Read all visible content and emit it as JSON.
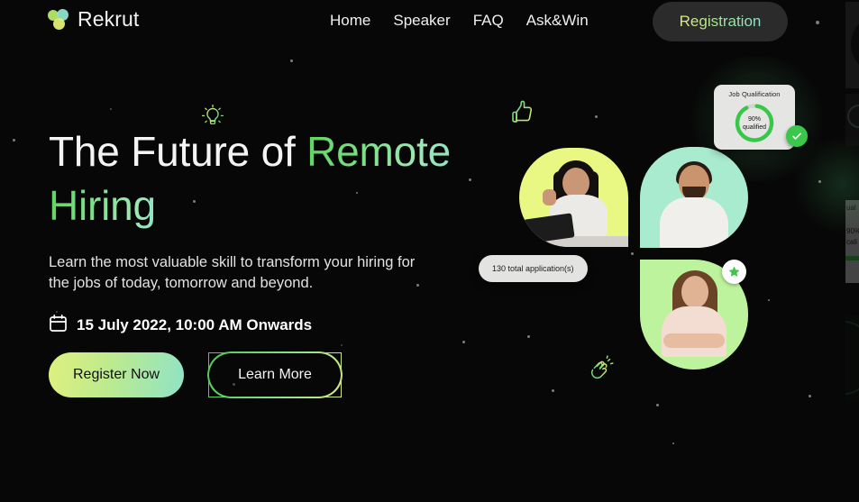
{
  "brand": {
    "name": "Rekrut",
    "logo_icon": "three-circles-logo-icon",
    "logo_colors": [
      "#b6e86a",
      "#8fe3cf",
      "#e4ef72"
    ]
  },
  "nav": {
    "links": [
      {
        "label": "Home",
        "name": "nav-link-home"
      },
      {
        "label": "Speaker",
        "name": "nav-link-speaker"
      },
      {
        "label": "FAQ",
        "name": "nav-link-faq"
      },
      {
        "label": "Ask&Win",
        "name": "nav-link-askwin"
      }
    ],
    "cta": {
      "label": "Registration"
    }
  },
  "hero": {
    "headline_plain_1": "The Future of ",
    "headline_accent_1": "Remote",
    "headline_accent_2": "Hiring",
    "subhead": "Learn the most valuable skill to transform your hiring for the jobs of today, tomorrow and beyond.",
    "date_icon": "calendar-icon",
    "date": "15 July 2022, 10:00 AM Onwards",
    "primary_cta": "Register Now",
    "secondary_cta": "Learn More"
  },
  "decor": {
    "bulb_icon": "lightbulb-icon",
    "thumb_icon": "thumbs-up-icon",
    "clap_icon": "clapping-hands-icon"
  },
  "qualification_card": {
    "title": "Job Qualification",
    "percent_label": "90%",
    "status_label": "qualified",
    "percent_value": 90,
    "ring_color": "#39c74a",
    "ring_track_color": "#d2d4d1",
    "check_icon": "check-circle-icon"
  },
  "applications_pill": {
    "text": "130 total application(s)"
  },
  "avatars": [
    {
      "name": "avatar-person-1",
      "bg": "#e9f883",
      "alt": "woman waving at laptop"
    },
    {
      "name": "avatar-person-2",
      "bg": "#a9ebcf",
      "alt": "smiling man"
    },
    {
      "name": "avatar-person-3",
      "bg": "#bdf39c",
      "alt": "woman with arms crossed"
    }
  ],
  "star_badge": {
    "icon": "star-icon",
    "color": "#3bc74a"
  },
  "offscreen_panel": {
    "text_1": "ual",
    "text_2": "90%",
    "text_3": "cali"
  },
  "theme": {
    "background": "#070707",
    "accent_green": "#5fd45f",
    "accent_lime": "#e4ee7c",
    "accent_teal": "#8fe4d0",
    "text_primary": "#f4f4f4"
  }
}
